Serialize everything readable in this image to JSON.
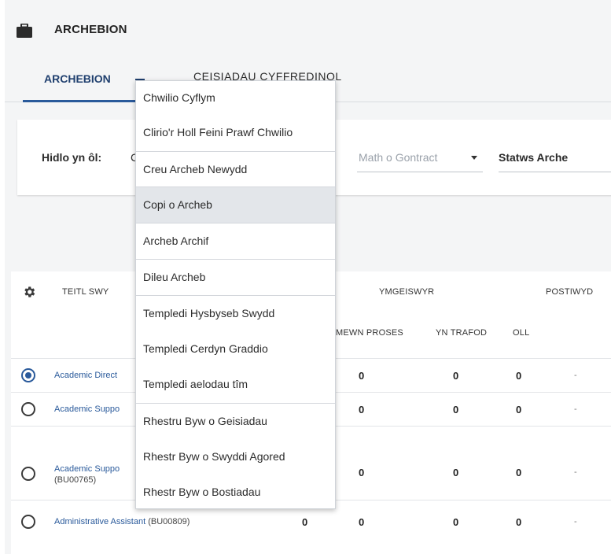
{
  "app": {
    "title": "ARCHEBION"
  },
  "tabs": [
    {
      "label": "ARCHEBION"
    },
    {
      "label": "CEISIADAU CYFFREDINOL"
    }
  ],
  "filter": {
    "label": "Hidlo yn ôl:",
    "peek": "C",
    "contract_placeholder": "Math o Gontract",
    "status_placeholder": "Statws Arche"
  },
  "table": {
    "headers": {
      "title": "TEITL SWY",
      "applicants": "YMGEISWYR",
      "posted": "POSTIWYD",
      "in_process": "MEWN PROSES",
      "in_discussion": "YN TRAFOD",
      "all": "OLL"
    },
    "rows": [
      {
        "title": "Academic Direct",
        "code": "",
        "code_line2": "",
        "c0": "",
        "c1": "0",
        "c2": "0",
        "c3": "0",
        "posted": "-",
        "selected": true
      },
      {
        "title": "Academic Suppo",
        "code": "",
        "code_line2": "",
        "c0": "",
        "c1": "0",
        "c2": "0",
        "c3": "0",
        "posted": "-",
        "selected": false
      },
      {
        "title": "Academic Suppo",
        "code": "",
        "code_line2": "(BU00765)",
        "c0": "",
        "c1": "0",
        "c2": "0",
        "c3": "0",
        "posted": "-",
        "selected": false
      },
      {
        "title": "Administrative Assistant",
        "code": "(BU00809)",
        "code_line2": "",
        "c0": "0",
        "c1": "0",
        "c2": "0",
        "c3": "0",
        "posted": "-",
        "selected": false
      }
    ]
  },
  "menu": {
    "items": [
      {
        "label": "Chwilio Cyflym"
      },
      {
        "label": "Clirio'r Holl Feini Prawf Chwilio"
      },
      {
        "label": "Creu Archeb Newydd"
      },
      {
        "label": "Copi o Archeb"
      },
      {
        "label": "Archeb Archif"
      },
      {
        "label": "Dileu Archeb"
      },
      {
        "label": "Templedi Hysbyseb Swydd"
      },
      {
        "label": "Templedi Cerdyn Graddio"
      },
      {
        "label": "Templedi aelodau tîm"
      },
      {
        "label": "Rhestru Byw o Geisiadau"
      },
      {
        "label": "Rhestr Byw o Swyddi Agored"
      },
      {
        "label": "Rhestr Byw o Bostiadau"
      }
    ]
  },
  "colors": {
    "accent": "#2a5a9b",
    "menu_highlight": "#e3e6ea"
  },
  "icons": {
    "app": "briefcase-icon",
    "table_settings": "gear-icon"
  }
}
